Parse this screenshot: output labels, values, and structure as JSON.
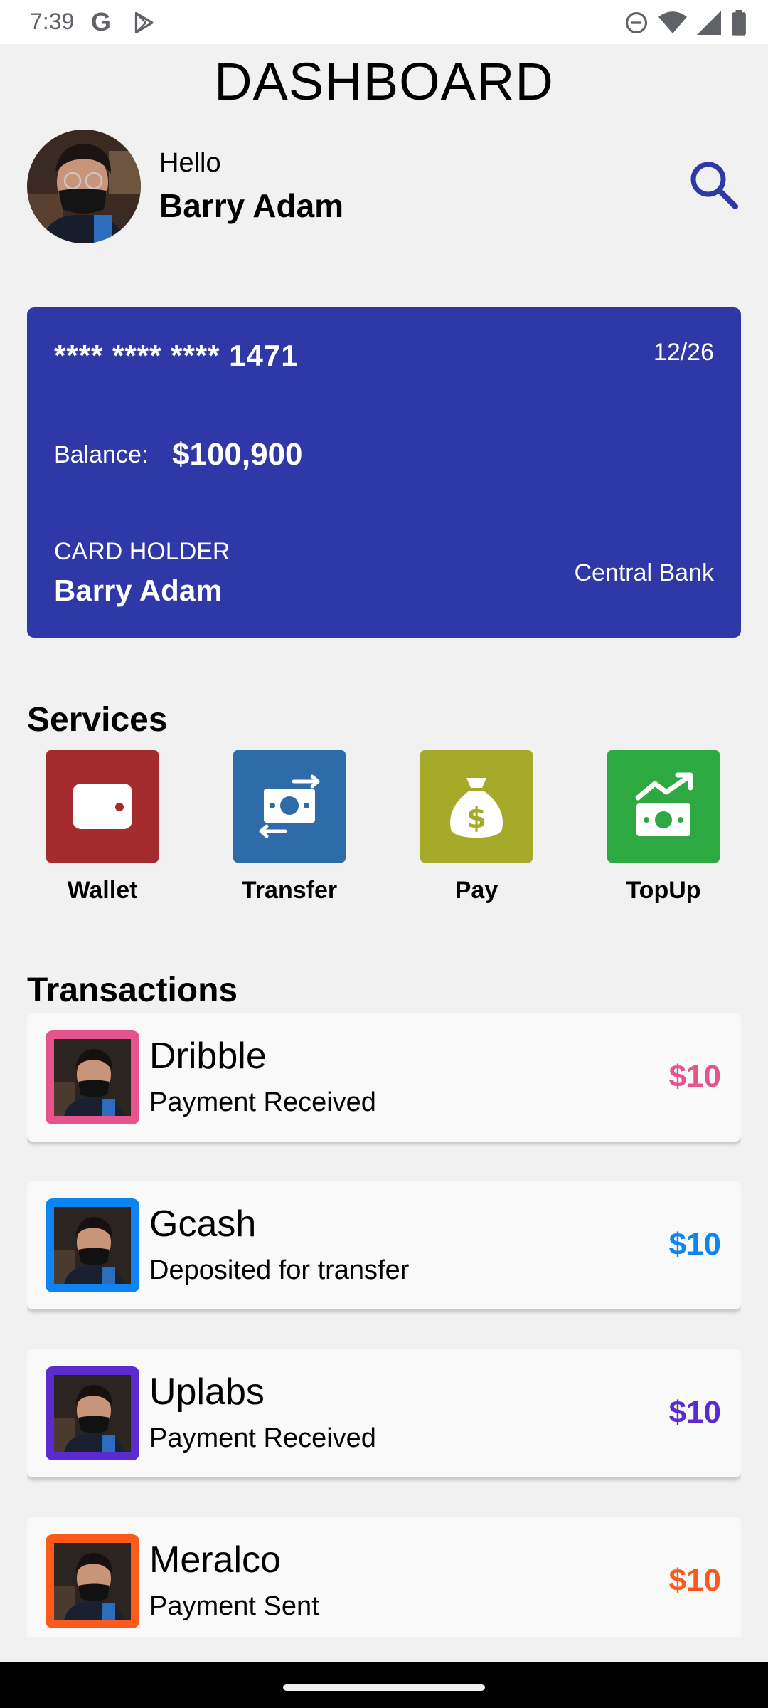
{
  "status_bar": {
    "time": "7:39",
    "g_glyph": "G",
    "icons": [
      "google-icon",
      "play-store-icon",
      "do-not-disturb-icon",
      "wifi-icon",
      "signal-icon",
      "battery-icon"
    ]
  },
  "header": {
    "title": "DASHBOARD",
    "greeting": "Hello",
    "user_name": "Barry Adam",
    "search_icon": "search-icon",
    "accent_color": "#2e38a6"
  },
  "card": {
    "number": "**** **** **** 1471",
    "expiry": "12/26",
    "balance_label": "Balance:",
    "balance": "$100,900",
    "holder_label": "CARD HOLDER",
    "holder_name": "Barry Adam",
    "bank": "Central Bank",
    "color": "#2e38a6"
  },
  "services": {
    "title": "Services",
    "items": [
      {
        "label": "Wallet",
        "icon": "wallet-icon",
        "color": "#a42c2f"
      },
      {
        "label": "Transfer",
        "icon": "money-transfer-icon",
        "color": "#2d6ca8"
      },
      {
        "label": "Pay",
        "icon": "money-bag-icon",
        "color": "#a6aa29"
      },
      {
        "label": "TopUp",
        "icon": "money-trend-up-icon",
        "color": "#2ea942"
      }
    ]
  },
  "transactions": {
    "title": "Transactions",
    "items": [
      {
        "name": "Dribble",
        "description": "Payment Received",
        "amount": "$10",
        "color": "#e5548d"
      },
      {
        "name": "Gcash",
        "description": "Deposited for transfer",
        "amount": "$10",
        "color": "#0d84f2"
      },
      {
        "name": "Uplabs",
        "description": "Payment Received",
        "amount": "$10",
        "color": "#5b2bd0"
      },
      {
        "name": "Meralco",
        "description": "Payment Sent",
        "amount": "$10",
        "color": "#fb5a1c"
      }
    ]
  }
}
